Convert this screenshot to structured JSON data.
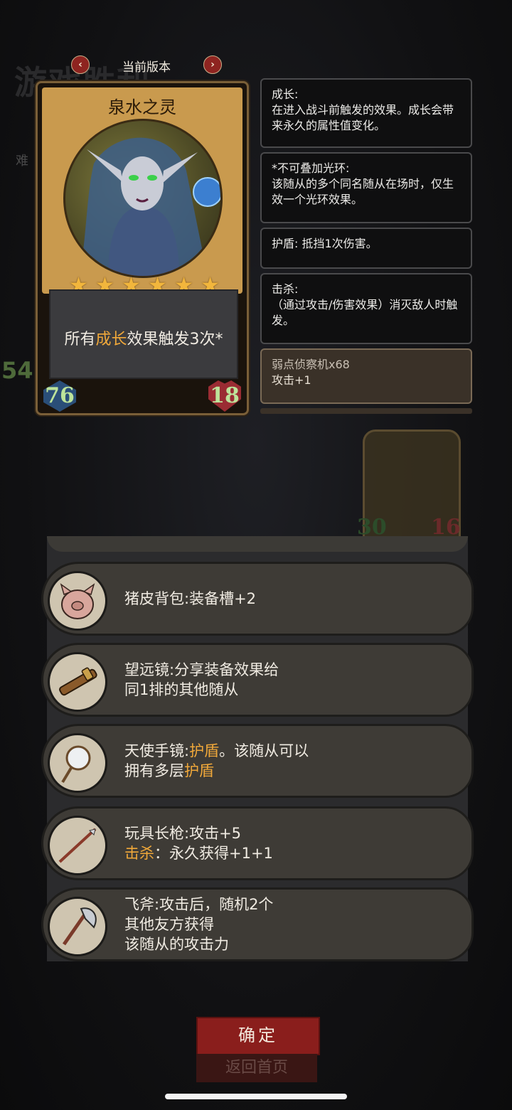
{
  "background": {
    "title_fragment": "游戏胜利",
    "difficulty_fragment": "难",
    "side_number": "54"
  },
  "version": {
    "label": "当前版本",
    "prev_icon": "chevron-left-icon",
    "next_icon": "chevron-right-icon"
  },
  "card": {
    "name": "泉水之灵",
    "stars": 6,
    "effect_prefix": "所有",
    "effect_keyword": "成长",
    "effect_suffix": "效果触发3次*",
    "attack": "76",
    "health": "18"
  },
  "info_panels": [
    {
      "title": "成长:",
      "text": "在进入战斗前触发的效果。成长会带来永久的属性值变化。"
    },
    {
      "title": "*不可叠加光环:",
      "text": "该随从的多个同名随从在场时，仅生效一个光环效果。"
    },
    {
      "title": "护盾: 抵挡1次伤害。",
      "text": ""
    },
    {
      "title": "击杀:",
      "text": "（通过攻击/伤害效果）消灭敌人时触发。"
    },
    {
      "title": "弱点侦察机x68",
      "text": "攻击+1"
    }
  ],
  "ghost_card": {
    "attack": "30",
    "health": "16"
  },
  "equipment": [
    {
      "icon": "pig-backpack-icon",
      "line1": "猪皮背包:装备槽+2",
      "line2": "",
      "line3": ""
    },
    {
      "icon": "telescope-icon",
      "line1": "望远镜:分享装备效果给",
      "line2": "同1排的其他随从",
      "line3": ""
    },
    {
      "icon": "angel-mirror-icon",
      "line1_a": "天使手镜:",
      "line1_kw": "护盾",
      "line1_b": "。该随从可以",
      "line2_a": "拥有多层",
      "line2_kw": "护盾"
    },
    {
      "icon": "toy-spear-icon",
      "line1": "玩具长枪:攻击+5",
      "line2_kw": "击杀",
      "line2_b": "：永久获得+1+1"
    },
    {
      "icon": "flying-axe-icon",
      "line1": "飞斧:攻击后，随机2个",
      "line2": "其他友方获得",
      "line3": "该随从的攻击力"
    }
  ],
  "buttons": {
    "confirm": "确定",
    "home": "返回首页"
  },
  "colors": {
    "keyword": "#f0a83a",
    "confirm_button": "#8a1e1c",
    "star": "#f2b63c"
  }
}
